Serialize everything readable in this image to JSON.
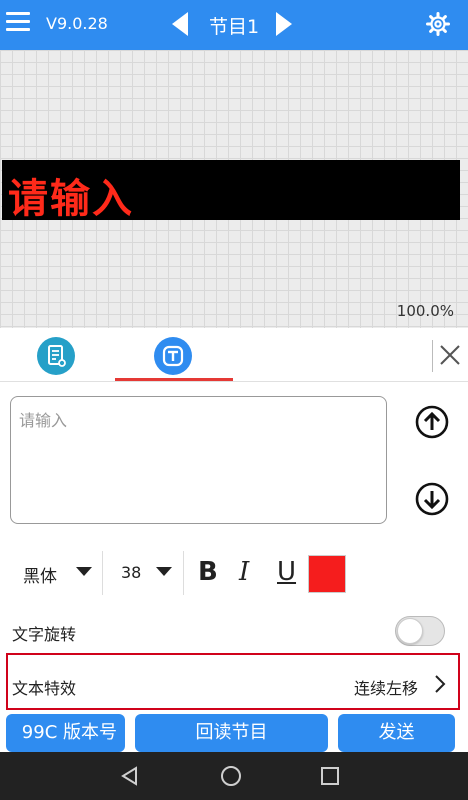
{
  "app": {
    "version": "V9.0.28",
    "program_title": "节目1",
    "colors": {
      "primary": "#2f8cf0",
      "led_text": "#ff2a1a",
      "tab_indicator": "#e53935",
      "highlight_border": "#d0021b"
    }
  },
  "header": {
    "menu_icon": "menu-icon",
    "prev_icon": "caret-left-icon",
    "next_icon": "caret-right-icon",
    "settings_icon": "gear-icon"
  },
  "preview": {
    "led_text": "请输入",
    "zoom": "100.0%"
  },
  "tabs": {
    "items": [
      {
        "icon": "document-icon",
        "selected": false
      },
      {
        "icon": "text-icon",
        "selected": true
      }
    ],
    "close_icon": "close-icon"
  },
  "editor": {
    "placeholder": "请输入",
    "value": "",
    "move_up_icon": "arrow-up-circle-icon",
    "move_down_icon": "arrow-down-circle-icon"
  },
  "font": {
    "family": "黑体",
    "size": "38",
    "bold_label": "B",
    "italic_label": "I",
    "underline_label": "U",
    "color": "#f51d1d"
  },
  "settings": {
    "rotate_label": "文字旋转",
    "rotate_enabled": false,
    "effect_label": "文本特效",
    "effect_value": "连续左移"
  },
  "buttons": {
    "version": "99C 版本号",
    "readback": "回读节目",
    "send": "发送"
  },
  "system_nav": {
    "back_icon": "back-triangle-icon",
    "home_icon": "home-circle-icon",
    "recent_icon": "recent-square-icon"
  }
}
